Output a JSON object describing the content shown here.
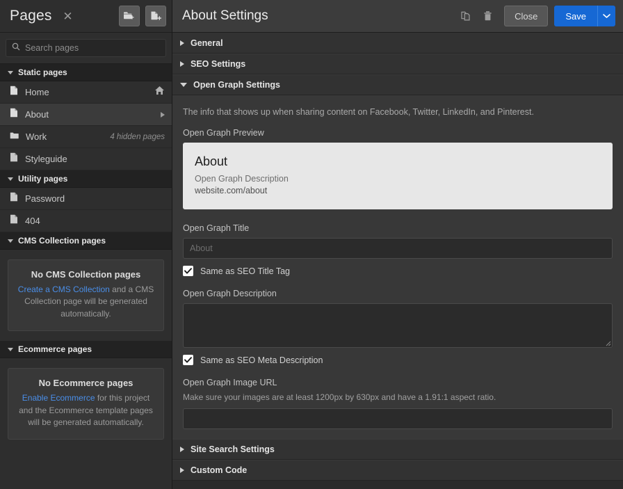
{
  "sidebar": {
    "title": "Pages",
    "close_icon": "close-icon",
    "new_folder_icon": "new-folder-icon",
    "new_page_icon": "new-page-icon",
    "search": {
      "placeholder": "Search pages",
      "value": ""
    },
    "sections": [
      {
        "id": "static-pages",
        "label": "Static pages",
        "expanded": true,
        "items": [
          {
            "name": "Home",
            "icon": "page-icon",
            "meta": "",
            "trailing_icon": "home-icon",
            "selected": false
          },
          {
            "name": "About",
            "icon": "page-icon",
            "meta": "",
            "trailing_icon": "chevron-right-icon",
            "selected": true
          },
          {
            "name": "Work",
            "icon": "folder-icon",
            "meta": "4 hidden pages",
            "trailing_icon": "",
            "selected": false
          },
          {
            "name": "Styleguide",
            "icon": "page-icon",
            "meta": "",
            "trailing_icon": "",
            "selected": false
          }
        ]
      },
      {
        "id": "utility-pages",
        "label": "Utility pages",
        "expanded": true,
        "items": [
          {
            "name": "Password",
            "icon": "page-icon",
            "meta": "",
            "trailing_icon": "",
            "selected": false
          },
          {
            "name": "404",
            "icon": "page-icon",
            "meta": "",
            "trailing_icon": "",
            "selected": false
          }
        ]
      },
      {
        "id": "cms-collection-pages",
        "label": "CMS Collection pages",
        "expanded": true,
        "empty_state": {
          "title": "No CMS Collection pages",
          "link": "Create a CMS Collection",
          "body": " and a CMS Collection page will be generated automatically."
        }
      },
      {
        "id": "ecommerce-pages",
        "label": "Ecommerce pages",
        "expanded": true,
        "empty_state": {
          "title": "No Ecommerce pages",
          "link": "Enable Ecommerce",
          "body": " for this project and the Ecommerce template pages will be generated automatically."
        }
      }
    ]
  },
  "main": {
    "title": "About Settings",
    "duplicate_icon": "duplicate-icon",
    "delete_icon": "trash-icon",
    "close_label": "Close",
    "save_label": "Save",
    "save_caret_icon": "chevron-down-icon",
    "accordions": [
      {
        "id": "general",
        "label": "General",
        "expanded": false
      },
      {
        "id": "seo-settings",
        "label": "SEO Settings",
        "expanded": false
      },
      {
        "id": "open-graph-settings",
        "label": "Open Graph Settings",
        "expanded": true
      },
      {
        "id": "site-search-settings",
        "label": "Site Search Settings",
        "expanded": false
      },
      {
        "id": "custom-code",
        "label": "Custom Code",
        "expanded": false
      }
    ],
    "open_graph": {
      "description": "The info that shows up when sharing content on Facebook, Twitter, LinkedIn, and Pinterest.",
      "preview_label": "Open Graph Preview",
      "preview": {
        "title": "About",
        "description": "Open Graph Description",
        "url": "website.com/about"
      },
      "title_label": "Open Graph Title",
      "title_placeholder": "About",
      "title_value": "",
      "same_as_seo_title_label": "Same as SEO Title Tag",
      "same_as_seo_title_checked": true,
      "desc_label": "Open Graph Description",
      "desc_value": "",
      "same_as_seo_desc_label": "Same as SEO Meta Description",
      "same_as_seo_desc_checked": true,
      "image_url_label": "Open Graph Image URL",
      "image_url_hint": "Make sure your images are at least 1200px by 630px and have a 1.91:1 aspect ratio.",
      "image_url_value": ""
    }
  },
  "colors": {
    "accent_blue": "#1668d4",
    "link_blue": "#4a8ee8",
    "panel_bg": "#383838",
    "sidebar_bg": "#2e2e2e"
  }
}
